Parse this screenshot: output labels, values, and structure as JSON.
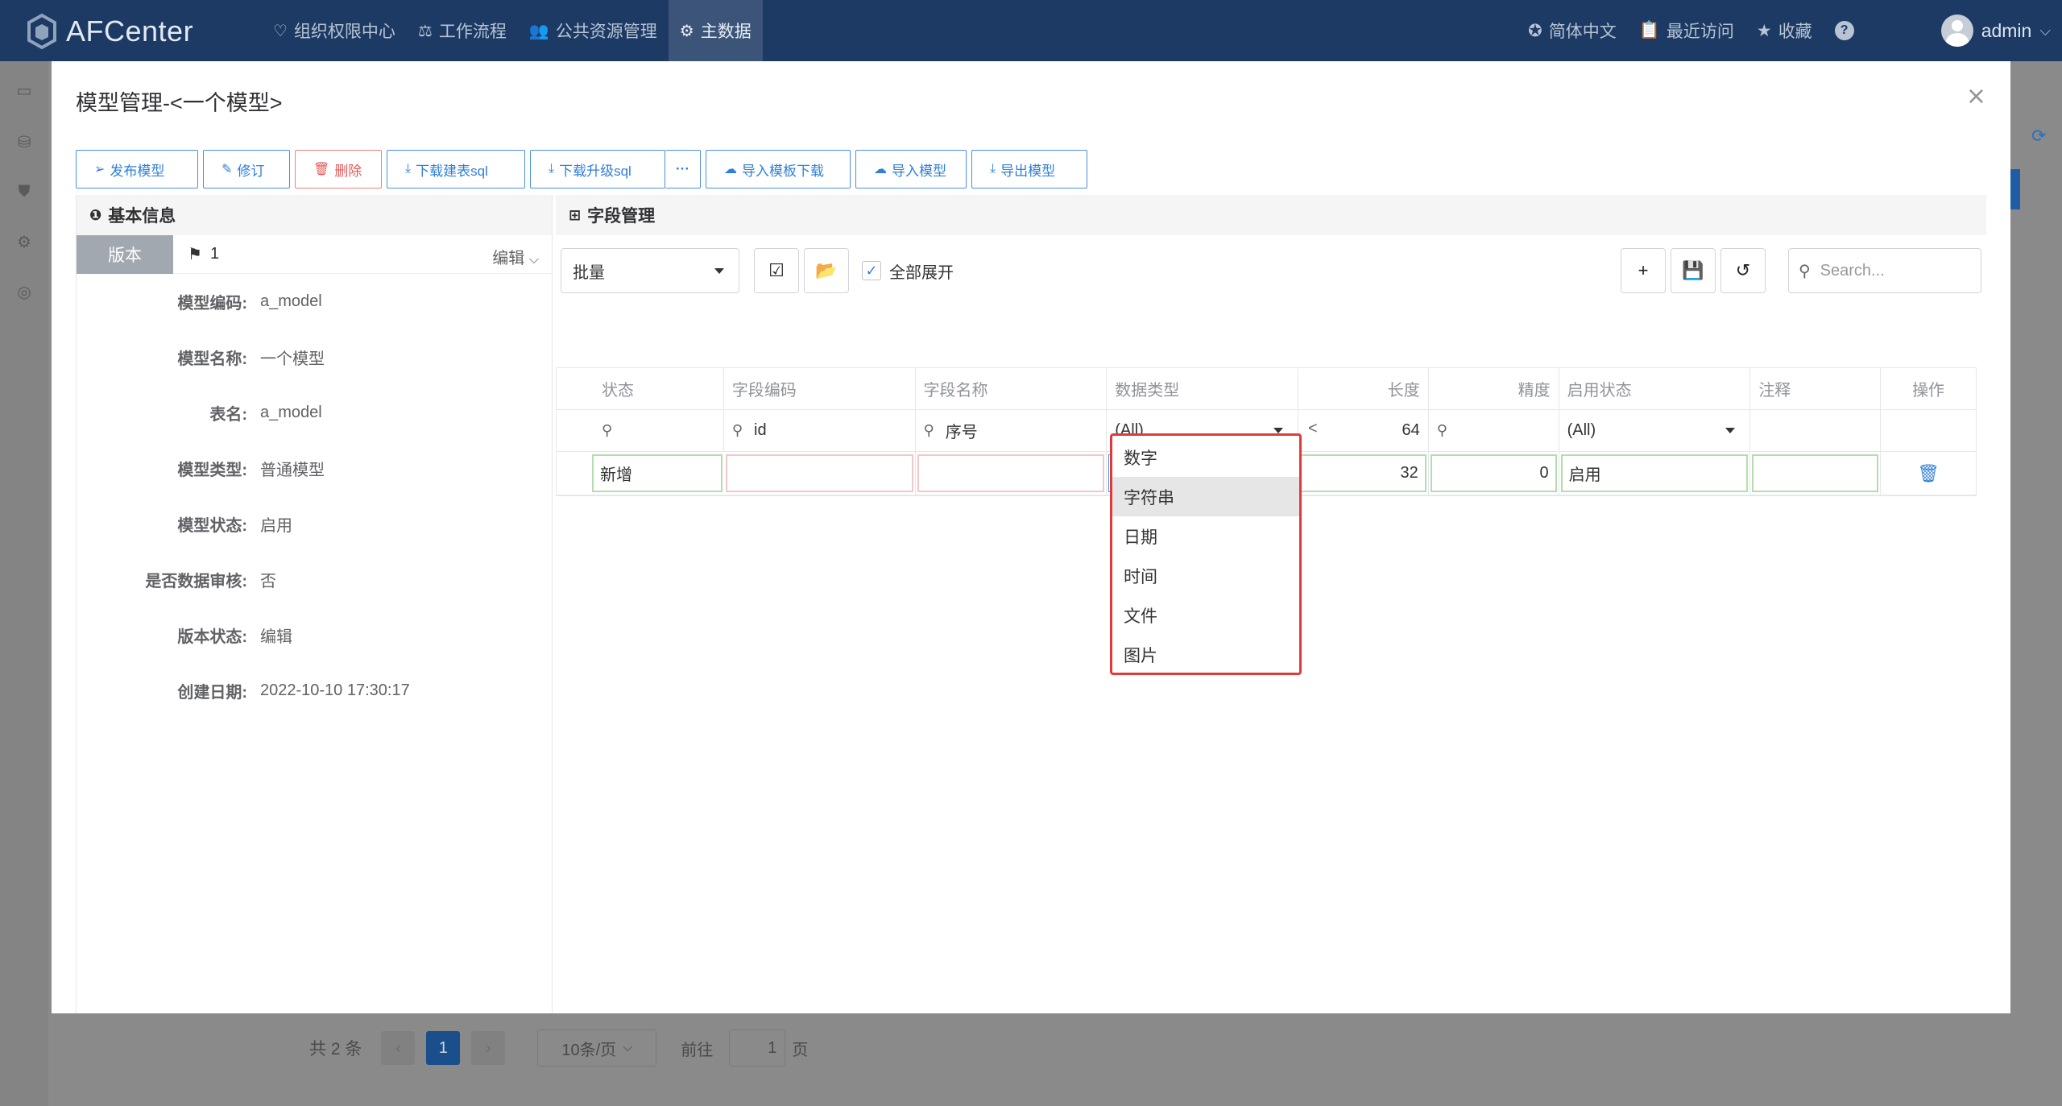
{
  "app": {
    "name": "AFCenter"
  },
  "nav": [
    {
      "icon": "heart-icon",
      "glyph": "♡",
      "label": "组织权限中心"
    },
    {
      "icon": "scale-icon",
      "glyph": "⚖",
      "label": "工作流程"
    },
    {
      "icon": "users-icon",
      "glyph": "👥",
      "label": "公共资源管理"
    },
    {
      "icon": "master-data-icon",
      "glyph": "⚙",
      "label": "主数据"
    }
  ],
  "topright": {
    "language": "简体中文",
    "recent": "最近访问",
    "favorites": "收藏",
    "help": "?",
    "user": "admin"
  },
  "pager": {
    "total": "共 2 条",
    "prev": "‹",
    "current": "1",
    "next": "›",
    "page_size": "10条/页",
    "goto": "前往",
    "goto_value": "1",
    "unit": "页"
  },
  "modal": {
    "title": "模型管理-<一个模型>",
    "close": "×",
    "toolbar": [
      {
        "name": "publish-model-button",
        "icon": "send-icon",
        "glyph": "➢",
        "label": "发布模型",
        "danger": false
      },
      {
        "name": "revise-button",
        "icon": "edit-icon",
        "glyph": "✎",
        "label": "修订",
        "danger": false
      },
      {
        "name": "delete-button",
        "icon": "trash-icon",
        "glyph": "🗑",
        "label": "删除",
        "danger": true
      },
      {
        "name": "download-create-sql-button",
        "icon": "download-icon",
        "glyph": "⤓",
        "label": "下载建表sql",
        "danger": false
      },
      {
        "name": "download-upgrade-sql-button",
        "icon": "download-icon",
        "glyph": "⤓",
        "label": "下载升级sql",
        "danger": false
      },
      {
        "name": "more-button",
        "icon": "ellipsis-icon",
        "glyph": "",
        "label": "···",
        "danger": false,
        "more": true
      },
      {
        "name": "import-template-download-button",
        "icon": "cloud-download-icon",
        "glyph": "☁",
        "label": "导入模板下载",
        "danger": false
      },
      {
        "name": "import-model-button",
        "icon": "cloud-upload-icon",
        "glyph": "☁",
        "label": "导入模型",
        "danger": false
      },
      {
        "name": "export-model-button",
        "icon": "download-icon",
        "glyph": "⤓",
        "label": "导出模型",
        "danger": false
      }
    ]
  },
  "basic": {
    "title": "基本信息",
    "version_tab": "版本",
    "version_num": "1",
    "edit_label": "编辑",
    "fields": [
      {
        "label": "模型编码:",
        "value": "a_model"
      },
      {
        "label": "模型名称:",
        "value": "一个模型"
      },
      {
        "label": "表名:",
        "value": "a_model"
      },
      {
        "label": "模型类型:",
        "value": "普通模型"
      },
      {
        "label": "模型状态:",
        "value": "启用"
      },
      {
        "label": "是否数据审核:",
        "value": "否"
      },
      {
        "label": "版本状态:",
        "value": "编辑"
      },
      {
        "label": "创建日期:",
        "value": "2022-10-10 17:30:17"
      }
    ]
  },
  "fields": {
    "title": "字段管理",
    "batch": "批量",
    "expand_all": "全部展开",
    "search_placeholder": "Search...",
    "columns": [
      "状态",
      "字段编码",
      "字段名称",
      "数据类型",
      "长度",
      "精度",
      "启用状态",
      "注释",
      "操作"
    ],
    "filters": {
      "code": "id",
      "name": "序号",
      "type": "(All)",
      "length_op": "<",
      "length": "64",
      "enabled": "(All)"
    },
    "row": {
      "status": "新增",
      "code": "",
      "name": "",
      "type": "字符串",
      "length": "32",
      "precision": "0",
      "enabled": "启用",
      "comment": ""
    },
    "type_options": [
      "数字",
      "字符串",
      "日期",
      "时间",
      "文件",
      "图片"
    ],
    "selected_option": "字符串"
  }
}
